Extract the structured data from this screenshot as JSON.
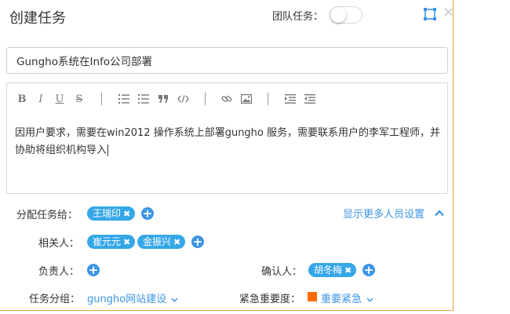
{
  "dialog": {
    "title": "创建任务",
    "team_task_label": "团队任务：",
    "team_task_on": false,
    "close_symbol": "×"
  },
  "task_title": {
    "value": "Gungho系统在Info公司部署"
  },
  "editor": {
    "toolbar": {
      "bold": "B",
      "italic": "I",
      "underline": "U",
      "strikethrough": "S"
    },
    "content": "因用户要求，需要在win2012 操作系统上部署gungho 服务，需要联系用户的李军工程师，并协助将组织机构导入"
  },
  "assign": {
    "label": "分配任务给：",
    "tags": [
      {
        "name": "王瑞印",
        "remove": "✖"
      }
    ],
    "show_more": "显示更多人员设置"
  },
  "related": {
    "label": "相关人：",
    "tags": [
      {
        "name": "崔元元",
        "remove": "✖"
      },
      {
        "name": "金振兴",
        "remove": "✖"
      }
    ]
  },
  "owner": {
    "label": "负责人："
  },
  "confirmer": {
    "label": "确认人：",
    "tags": [
      {
        "name": "胡冬梅",
        "remove": "✖"
      }
    ]
  },
  "group": {
    "label": "任务分组：",
    "value": "gungho网站建设"
  },
  "urgency": {
    "label": "紧急重要度：",
    "value": "重要紧急",
    "color": "#ff6a00"
  },
  "colors": {
    "accent": "#3d95e6",
    "tag": "#35a7e8",
    "border": "#f0a040"
  }
}
